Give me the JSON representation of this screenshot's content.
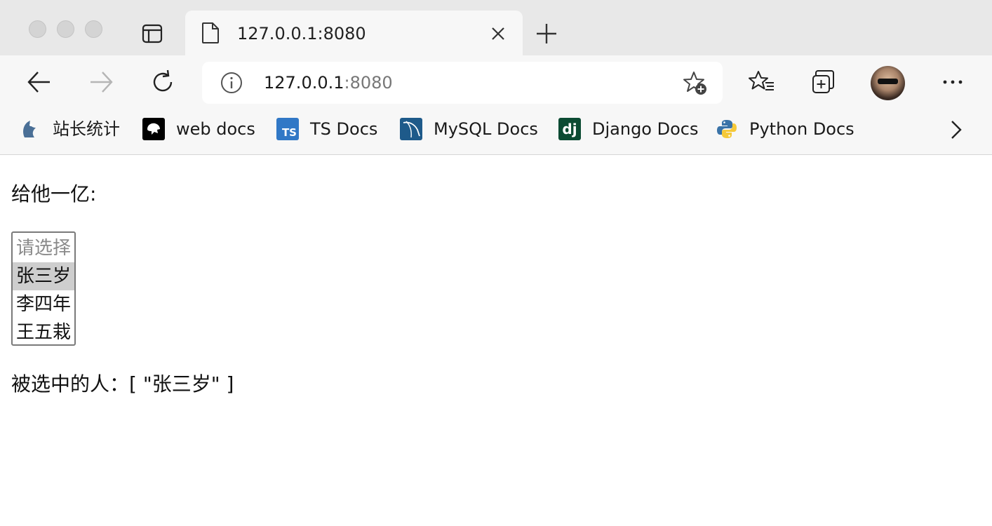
{
  "tab": {
    "title": "127.0.0.1:8080"
  },
  "address_bar": {
    "host": "127.0.0.1",
    "port": ":8080"
  },
  "bookmarks": [
    {
      "label": "站长统计",
      "icon": "zhanzhang-icon"
    },
    {
      "label": "web docs",
      "icon": "mdn-icon"
    },
    {
      "label": "TS Docs",
      "icon": "typescript-icon",
      "icon_text": "TS",
      "color": "#3178c6"
    },
    {
      "label": "MySQL Docs",
      "icon": "mysql-icon",
      "color": "#1e5a8a"
    },
    {
      "label": "Django Docs",
      "icon": "django-icon",
      "icon_text": "dj",
      "color": "#0c4b33"
    },
    {
      "label": "Python Docs",
      "icon": "python-icon"
    }
  ],
  "page": {
    "label": "给他一亿:",
    "select": {
      "options": [
        "请选择",
        "张三岁",
        "李四年",
        "王五栽"
      ],
      "selected_index": 1
    },
    "selected_prefix": "被选中的人：",
    "selected_value": "[ \"张三岁\" ]"
  }
}
